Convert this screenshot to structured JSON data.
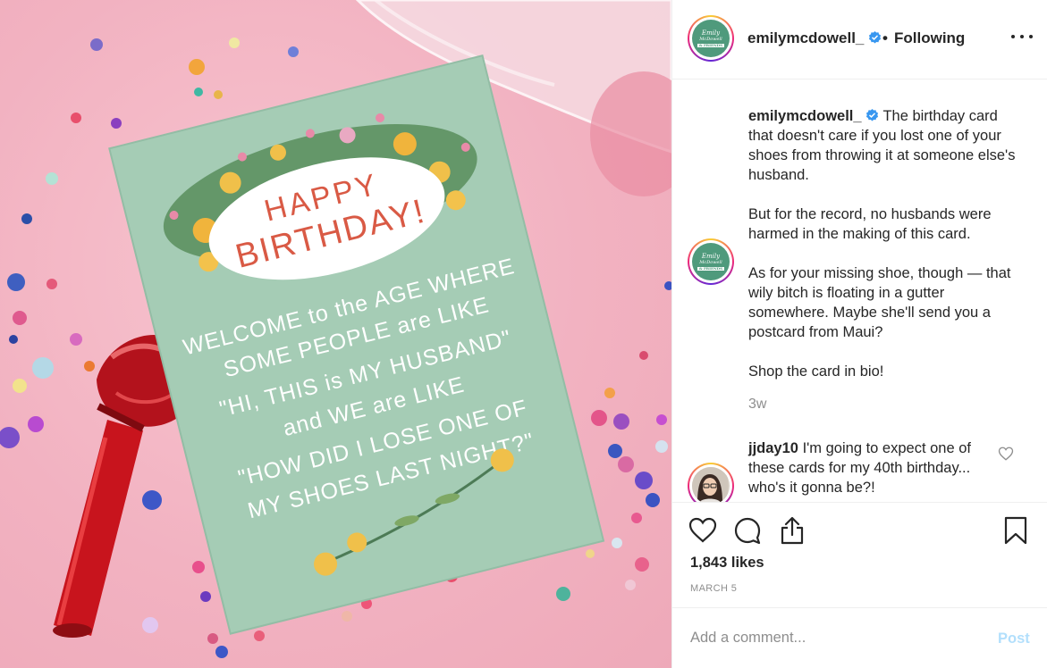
{
  "post": {
    "username": "emilymcdowell_",
    "separator": "•",
    "follow_status": "Following",
    "avatar_logo": {
      "line1": "Emily",
      "line2": "McDowell",
      "line3": "& FRIENDS"
    },
    "card_text": {
      "happy": "HAPPY",
      "birthday": "BIRTHDAY!",
      "lines": [
        "WELCOME to the AGE WHERE",
        "SOME PEOPLE are LIKE",
        "\"HI, THIS is MY HUSBAND\"",
        "and WE are LIKE",
        "\"HOW DID I LOSE ONE OF",
        "MY SHOES LAST NIGHT?\""
      ]
    }
  },
  "caption": {
    "username": "emilymcdowell_",
    "paragraphs": [
      "The birthday card that doesn't care if you lost one of your shoes from throwing it at someone else's husband.",
      "But for the record, no husbands were harmed in the making of this card.",
      "As for your missing shoe, though — that wily bitch is floating in a gutter somewhere. Maybe she'll send you a postcard from Maui?",
      "Shop the card in bio!"
    ],
    "age": "3w"
  },
  "comments": [
    {
      "username": "jjday10",
      "text": "I'm going to expect one of these cards for my 40th birthday... who's it gonna be?!"
    }
  ],
  "actions": {
    "likes": "1,843 likes",
    "date": "MARCH 5"
  },
  "add_comment": {
    "placeholder": "Add a comment...",
    "post_label": "Post"
  },
  "icons": {
    "verified": "verified-badge-icon",
    "more": "more-options-icon",
    "like": "heart-icon",
    "comment": "comment-icon",
    "share": "share-icon",
    "save": "bookmark-icon"
  },
  "colors": {
    "verified_blue": "#3897f0",
    "card_green": "#a5ccb5",
    "photo_pink": "#f2b2c1",
    "post_button": "#b2dffc",
    "muted_text": "#8e8e8e"
  }
}
